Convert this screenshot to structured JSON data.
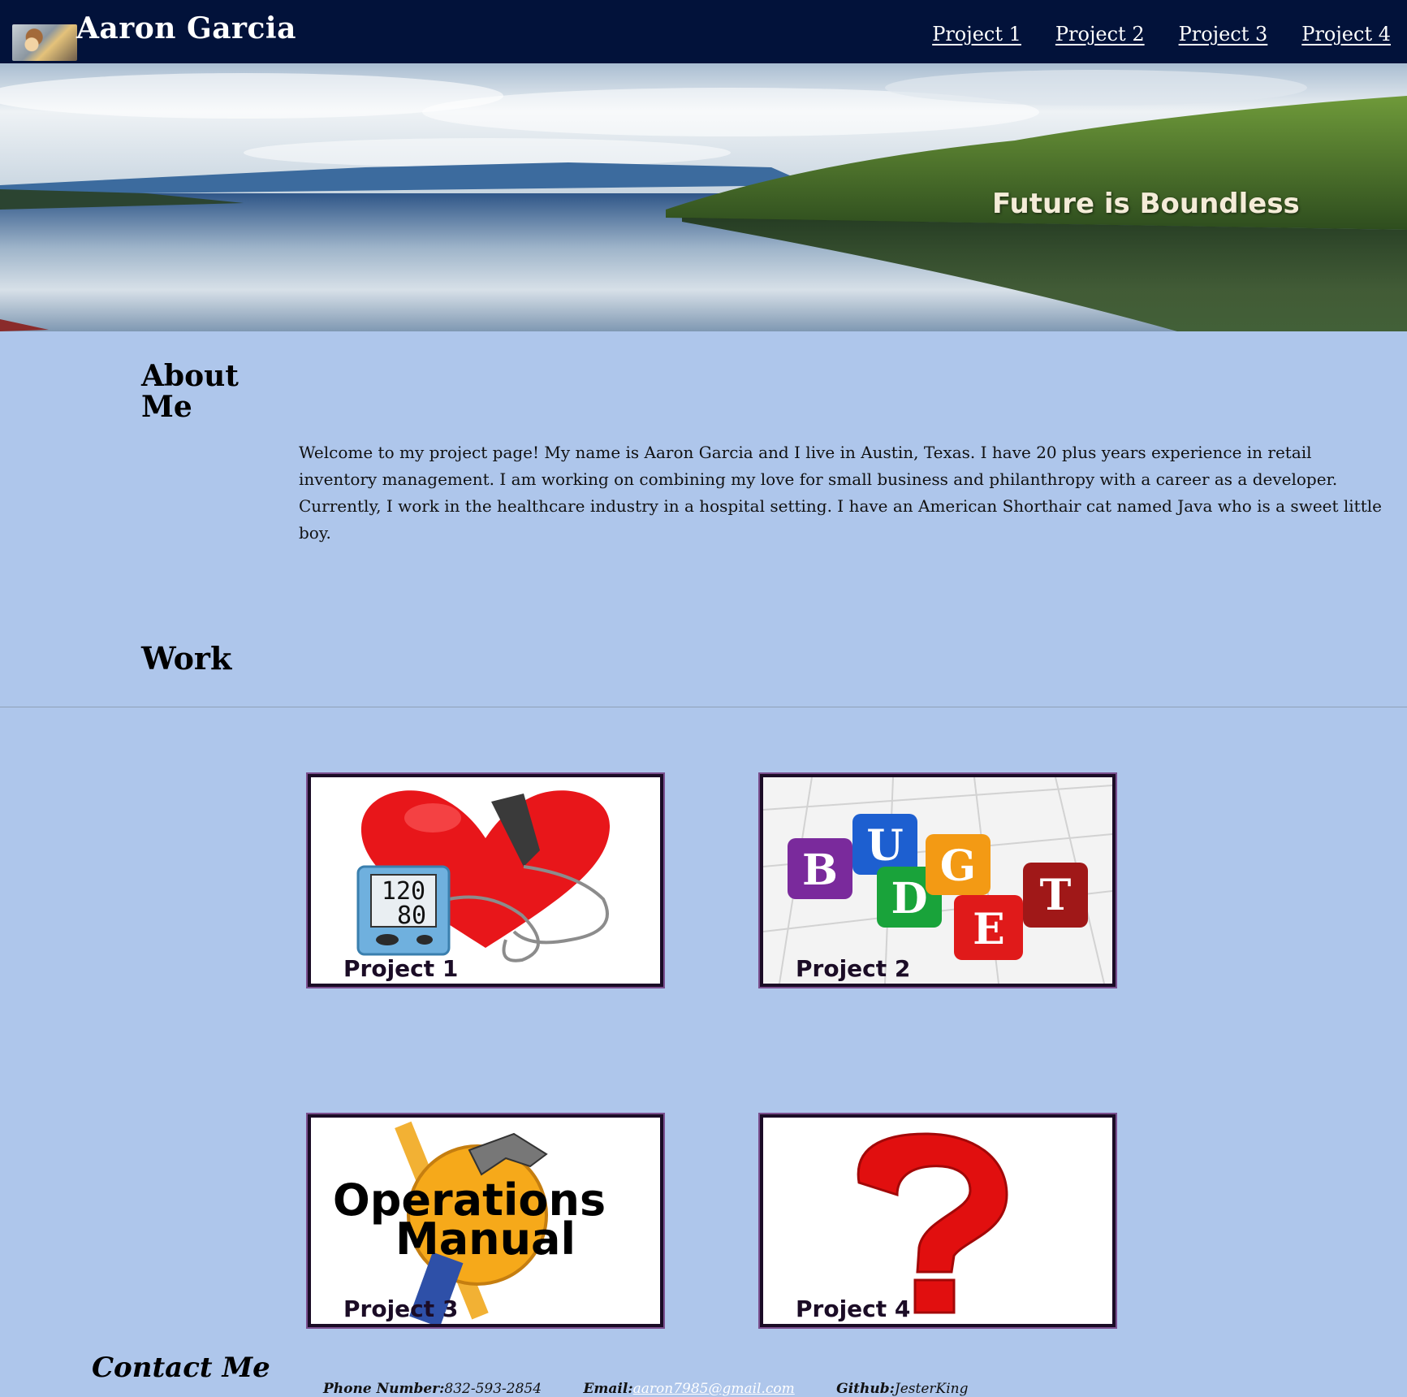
{
  "header": {
    "site_title": "Aaron Garcia",
    "avatar_icon": "profile-photo",
    "nav": [
      "Project 1",
      "Project 2",
      "Project 3",
      "Project 4"
    ]
  },
  "hero": {
    "tagline": "Future is Boundless",
    "image": "lake-landscape"
  },
  "about": {
    "heading": "About Me",
    "text": "Welcome to my project page! My name is Aaron Garcia and I live in Austin, Texas. I have 20 plus years experience in retail inventory management. I am working on combining my love for small business and philanthropy with a career as a developer. Currently, I work in the healthcare industry in a hospital setting. I have an American Shorthair cat named Java who is a sweet little boy."
  },
  "work": {
    "heading": "Work",
    "projects": [
      {
        "label": "Project 1",
        "image": "blood-pressure-heart",
        "bp_top": "120",
        "bp_bottom": "80"
      },
      {
        "label": "Project 2",
        "image": "budget-blocks",
        "letters": [
          "B",
          "U",
          "D",
          "G",
          "E",
          "T"
        ]
      },
      {
        "label": "Project 3",
        "image": "operations-manual",
        "line1": "Operations",
        "line2": "Manual"
      },
      {
        "label": "Project 4",
        "image": "question-mark"
      }
    ]
  },
  "contact": {
    "heading": "Contact Me",
    "phone_label": "Phone Number:",
    "phone": "832-593-2854",
    "email_label": "Email:",
    "email": "aaron7985@gmail.com",
    "github_label": "Github:",
    "github": "JesterKing"
  },
  "colors": {
    "header_bg": "#02123a",
    "page_bg": "#aec6eb",
    "card_border": "#1b0c26",
    "tagline": "#f4ecd8"
  }
}
